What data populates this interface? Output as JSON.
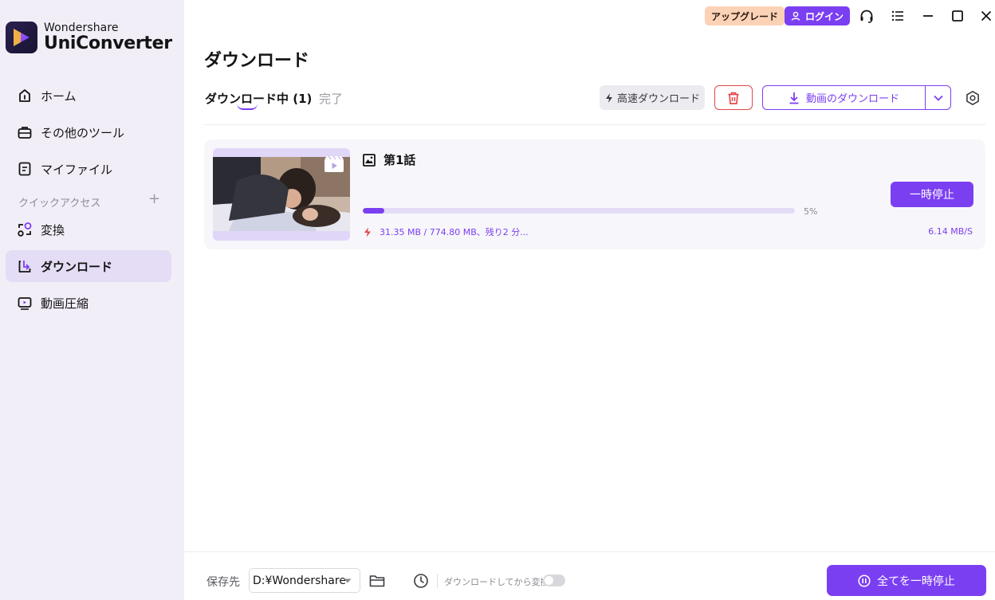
{
  "app": {
    "brand_top": "Wondershare",
    "brand_bottom": "UniConverter"
  },
  "titlebar": {
    "upgrade_label": "アップグレード",
    "login_label": "ログイン",
    "icons": [
      "headset-icon",
      "menu-icon",
      "minimize-icon",
      "maximize-icon",
      "close-icon"
    ]
  },
  "sidebar": {
    "items": [
      {
        "label": "ホーム",
        "icon": "home-icon"
      },
      {
        "label": "その他のツール",
        "icon": "toolbox-icon"
      },
      {
        "label": "マイファイル",
        "icon": "file-icon"
      }
    ],
    "quick_access_label": "クイックアクセス",
    "quick_add": "+",
    "quick_items": [
      {
        "label": "変換",
        "icon": "convert-icon"
      },
      {
        "label": "ダウンロード",
        "icon": "download-icon",
        "active": true
      },
      {
        "label": "動画圧縮",
        "icon": "compress-icon"
      }
    ]
  },
  "main": {
    "title": "ダウンロード",
    "tabs": [
      {
        "label": "ダウンロード中 (1)",
        "active": true
      },
      {
        "label": "完了",
        "active": false
      }
    ],
    "high_speed_label": "高速ダウンロード",
    "download_video_label": "動画のダウンロード"
  },
  "download_item": {
    "title": "第1話",
    "progress_percent": 5,
    "percent_label": "5%",
    "stats": "31.35 MB / 774.80 MB、残り2 分...",
    "speed": "6.14 MB/S",
    "pause_label": "一時停止"
  },
  "bottom": {
    "save_label": "保存先",
    "path": "D:¥Wondershare",
    "convert_after_label": "ダウンロードしてから変換",
    "pause_all_label": "全てを一時停止"
  },
  "colors": {
    "accent": "#7b3ff2",
    "sidebar_bg": "#f1eef8",
    "active_nav_bg": "#e5dcf6",
    "upgrade_bg": "#fbd2b6",
    "danger": "#e54848"
  }
}
